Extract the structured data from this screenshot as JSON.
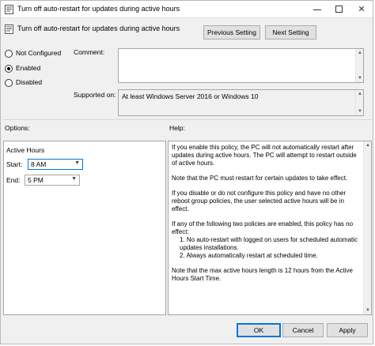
{
  "window": {
    "title": "Turn off auto-restart for updates during active hours",
    "minimize_icon": "minimize-icon",
    "maximize_icon": "maximize-icon",
    "close_symbol": "✕"
  },
  "header": {
    "policy_name": "Turn off auto-restart for updates during active hours",
    "previous_setting": "Previous Setting",
    "next_setting": "Next Setting"
  },
  "state": {
    "options": [
      {
        "label": "Not Configured",
        "checked": false
      },
      {
        "label": "Enabled",
        "checked": true
      },
      {
        "label": "Disabled",
        "checked": false
      }
    ]
  },
  "comment": {
    "label": "Comment:",
    "value": ""
  },
  "supported": {
    "label": "Supported on:",
    "value": "At least Windows Server 2016 or Windows 10"
  },
  "options_section": {
    "label": "Options:",
    "group_title": "Active Hours",
    "start_label": "Start:",
    "start_value": "8 AM",
    "end_label": "End:",
    "end_value": "5 PM"
  },
  "help_section": {
    "label": "Help:",
    "paragraphs": [
      "If you enable this policy, the PC will not automatically restart after updates during active hours. The PC will attempt to restart outside of active hours.",
      "Note that the PC must restart for certain updates to take effect.",
      "If you disable or do not configure this policy and have no other reboot group policies, the user selected active hours will be in effect.",
      "If any of the following two policies are enabled, this policy has no effect:",
      "1. No auto-restart with logged on users for scheduled automatic updates installations.",
      "2. Always automatically restart at scheduled time.",
      "Note that the max active hours length is 12 hours from the Active Hours Start Time."
    ]
  },
  "footer": {
    "ok": "OK",
    "cancel": "Cancel",
    "apply": "Apply"
  },
  "colors": {
    "accent": "#0078d7",
    "dialog_bg": "#f0f0f0",
    "field_border": "#a6a6a6"
  }
}
